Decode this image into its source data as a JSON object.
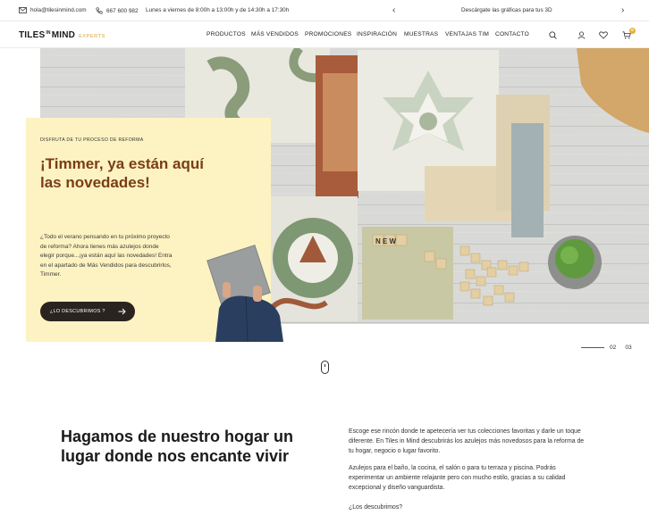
{
  "topbar": {
    "email": "hola@tilesinmind.com",
    "phone": "667 600 982",
    "hours": "Lunes a viernes de 8:00h a 13:00h y de 14:30h a 17:30h",
    "promo": "Descárgate las gráficas para tus 3D",
    "prev_icon": "‹",
    "next_icon": "›"
  },
  "nav": {
    "logo_main": "TILES",
    "logo_in": "IN",
    "logo_mind": "MIND",
    "logo_experts": "EXPERTS",
    "items": [
      "PRODUCTOS",
      "MÁS VENDIDOS",
      "PROMOCIONES",
      "INSPIRACIÓN",
      "MUESTRAS",
      "VENTAJAS TIM",
      "CONTACTO"
    ],
    "cart_count": "0"
  },
  "hero": {
    "eyebrow": "DISFRUTA DE TU PROCESO DE REFORMA",
    "title": "¡Timmer, ya están aquí las novedades!",
    "body": "¿Todo el verano pensando en tu próximo proyecto de reforma? Ahora tienes más azulejos donde elegir porque...¡ya están aquí las novedades! Entra en el apartado de Más Vendidos para descubrirlos, Timmer.",
    "cta": "¿LO DESCUBRIMOS ?",
    "scrabble_word": "N E W",
    "slide_numbers": [
      "02",
      "03"
    ]
  },
  "intro": {
    "heading": "Hagamos de nuestro hogar un lugar donde nos encante vivir",
    "p1": "Escoge ese rincón donde te apetecería ver tus colecciones favoritas y darle un toque diferente. En Tiles in Mind descubrirás los azulejos más novedosos para la reforma de tu hogar, negocio o lugar favorito.",
    "p2": "Azulejos para el baño, la cocina, el salón o para tu terraza y piscina. Podrás experimentar un ambiente relajante pero con mucho estilo, gracias a su calidad excepcional y diseño vanguardista.",
    "p3": "¿Los descubrimos?"
  },
  "colors": {
    "accent": "#e4b13a",
    "card_bg": "#fdf3c2",
    "title_brown": "#7a3d17",
    "cta_dark": "#2a2420"
  },
  "icons": [
    "mail-icon",
    "phone-icon",
    "search-icon",
    "user-icon",
    "heart-icon",
    "cart-icon",
    "arrow-right-icon",
    "mouse-scroll-icon"
  ]
}
